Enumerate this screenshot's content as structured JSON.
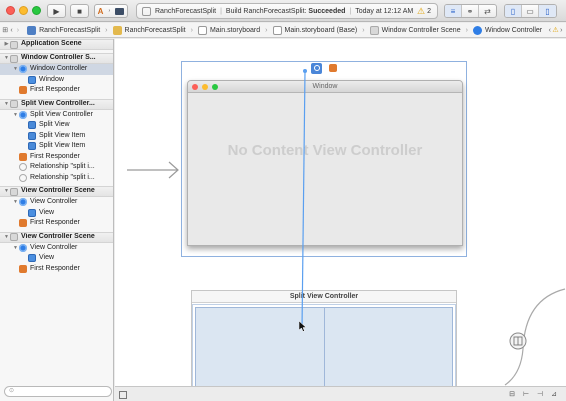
{
  "toolbar": {
    "run_icon": "play-icon",
    "stop_icon": "stop-icon",
    "scheme_icon": "app-icon",
    "project": "RanchForecastSplit",
    "build_prefix": "Build RanchForecastSplit:",
    "build_status": "Succeeded",
    "build_time": "Today at 12:12 AM",
    "warning_count": "2"
  },
  "jumpbar": {
    "crumbs": [
      "RanchForecastSplit",
      "RanchForecastSplit",
      "Main.storyboard",
      "Main.storyboard (Base)",
      "Window Controller Scene",
      "Window Controller"
    ]
  },
  "outline": {
    "rows": [
      {
        "label": "Application Scene",
        "kind": "scene",
        "depth": 0,
        "icon": "scene-icon",
        "tri": "▶"
      },
      {
        "label": "Window Controller S...",
        "kind": "scene",
        "depth": 0,
        "icon": "scene-icon",
        "tri": "▼"
      },
      {
        "label": "Window Controller",
        "kind": "item",
        "depth": 1,
        "icon": "controller-icon",
        "tri": "▼",
        "selected": true
      },
      {
        "label": "Window",
        "kind": "item",
        "depth": 2,
        "icon": "window-icon",
        "tri": ""
      },
      {
        "label": "First Responder",
        "kind": "item",
        "depth": 1,
        "icon": "first-responder-icon",
        "tri": ""
      },
      {
        "label": "Split View Controller...",
        "kind": "scene",
        "depth": 0,
        "icon": "scene-icon",
        "tri": "▼"
      },
      {
        "label": "Split View Controller",
        "kind": "item",
        "depth": 1,
        "icon": "controller-icon",
        "tri": "▼"
      },
      {
        "label": "Split View",
        "kind": "item",
        "depth": 2,
        "icon": "split-view-icon",
        "tri": ""
      },
      {
        "label": "Split View Item",
        "kind": "item",
        "depth": 2,
        "icon": "split-item-icon",
        "tri": ""
      },
      {
        "label": "Split View Item",
        "kind": "item",
        "depth": 2,
        "icon": "split-item-icon",
        "tri": ""
      },
      {
        "label": "First Responder",
        "kind": "item",
        "depth": 1,
        "icon": "first-responder-icon",
        "tri": ""
      },
      {
        "label": "Relationship \"split i...",
        "kind": "item",
        "depth": 1,
        "icon": "relationship-icon",
        "tri": ""
      },
      {
        "label": "Relationship \"split i...",
        "kind": "item",
        "depth": 1,
        "icon": "relationship-icon",
        "tri": ""
      },
      {
        "label": "View Controller Scene",
        "kind": "scene",
        "depth": 0,
        "icon": "scene-icon",
        "tri": "▼"
      },
      {
        "label": "View Controller",
        "kind": "item",
        "depth": 1,
        "icon": "controller-icon",
        "tri": "▼"
      },
      {
        "label": "View",
        "kind": "item",
        "depth": 2,
        "icon": "view-icon",
        "tri": ""
      },
      {
        "label": "First Responder",
        "kind": "item",
        "depth": 1,
        "icon": "first-responder-icon",
        "tri": ""
      },
      {
        "label": "View Controller Scene",
        "kind": "scene",
        "depth": 0,
        "icon": "scene-icon",
        "tri": "▼"
      },
      {
        "label": "View Controller",
        "kind": "item",
        "depth": 1,
        "icon": "controller-icon",
        "tri": "▼"
      },
      {
        "label": "View",
        "kind": "item",
        "depth": 2,
        "icon": "view-icon",
        "tri": ""
      },
      {
        "label": "First Responder",
        "kind": "item",
        "depth": 1,
        "icon": "first-responder-icon",
        "tri": ""
      }
    ]
  },
  "canvas": {
    "window_title": "Window",
    "no_content": "No Content View Controller",
    "split_title": "Split View Controller"
  },
  "colors": {
    "accent": "#2f7ee6",
    "connection": "#5a9ff0",
    "responder": "#e07a2e"
  }
}
